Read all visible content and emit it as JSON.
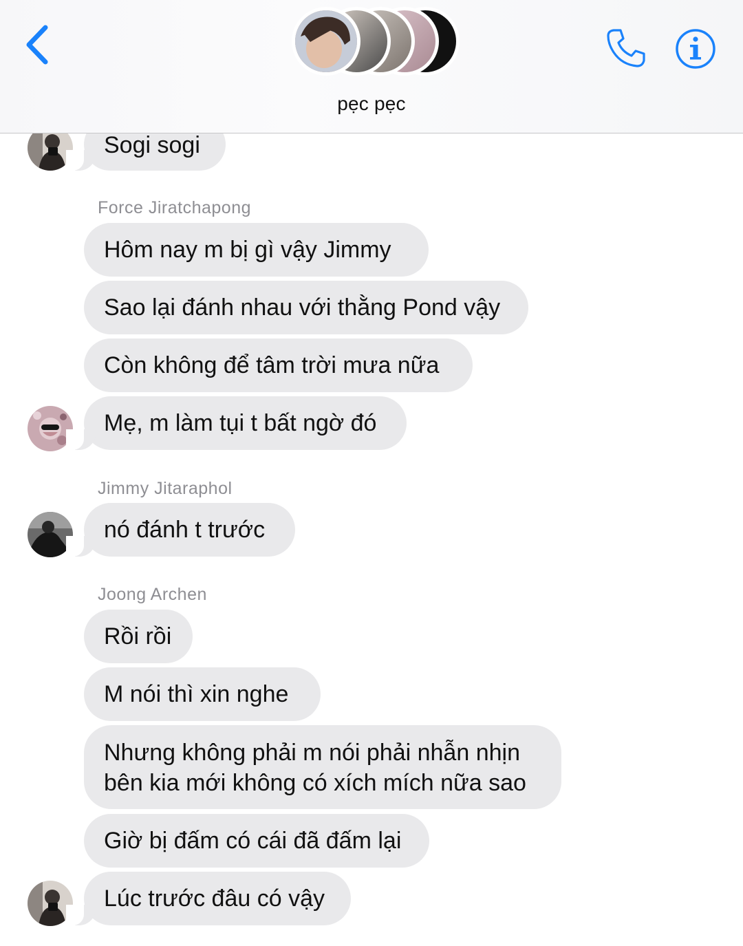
{
  "header": {
    "title": "pẹc pẹc",
    "accent_color": "#1a82fb",
    "icons": {
      "back": "chevron-left-icon",
      "call": "phone-icon",
      "info": "info-icon"
    }
  },
  "messages": [
    {
      "sender": "",
      "text": "Sogi sogi"
    },
    {
      "sender": "Force Jiratchapong",
      "text": "Hôm nay m bị gì vậy Jimmy"
    },
    {
      "sender": "",
      "text": "Sao lại đánh nhau với thằng Pond vậy"
    },
    {
      "sender": "",
      "text": "Còn không để tâm trời mưa nữa"
    },
    {
      "sender": "",
      "text": "Mẹ, m làm tụi t bất ngờ đó"
    },
    {
      "sender": "Jimmy Jitaraphol",
      "text": "nó đánh t trước"
    },
    {
      "sender": "Joong Archen",
      "text": "Rồi rồi"
    },
    {
      "sender": "",
      "text": "M nói thì xin nghe"
    },
    {
      "sender": "",
      "line1": "Nhưng không phải m nói phải nhẫn nhịn",
      "line2": "bên kia mới không có xích mích nữa sao"
    },
    {
      "sender": "",
      "text": "Giờ bị đấm có cái đã đấm lại"
    },
    {
      "sender": "",
      "text": "Lúc trước đâu có vậy"
    }
  ]
}
